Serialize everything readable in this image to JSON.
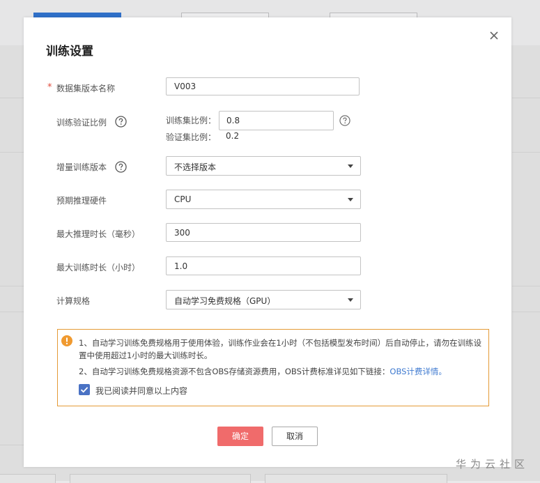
{
  "dialog": {
    "title": "训练设置",
    "close_icon": "close-icon"
  },
  "form": {
    "dataset_version": {
      "label": "数据集版本名称",
      "required_mark": "*",
      "value": "V003"
    },
    "validation_ratio": {
      "label": "训练验证比例",
      "train_label": "训练集比例：",
      "train_value": "0.8",
      "val_label": "验证集比例：",
      "val_value": "0.2"
    },
    "incremental_version": {
      "label": "增量训练版本",
      "selected": "不选择版本"
    },
    "inference_hardware": {
      "label": "预期推理硬件",
      "selected": "CPU"
    },
    "max_inference_time": {
      "label": "最大推理时长（毫秒）",
      "value": "300"
    },
    "max_training_time": {
      "label": "最大训练时长（小时）",
      "value": "1.0"
    },
    "compute_spec": {
      "label": "计算规格",
      "selected": "自动学习免费规格（GPU）"
    }
  },
  "notice": {
    "line1": "1、自动学习训练免费规格用于使用体验，训练作业会在1小时（不包括模型发布时间）后自动停止，请勿在训练设置中使用超过1小时的最大训练时长。",
    "line2_text": "2、自动学习训练免费规格资源不包含OBS存储资源费用，OBS计费标准详见如下链接：",
    "line2_link": "OBS计费详情。",
    "agree_label": "我已阅读并同意以上内容",
    "agree_checked": true
  },
  "buttons": {
    "confirm": "确定",
    "cancel": "取消"
  },
  "watermark": "华为云社区",
  "colors": {
    "primary": "#f06b6b",
    "link": "#3f7ad0",
    "warning_border": "#e49a36",
    "checkbox": "#4a72c4",
    "required": "#e04b3c"
  }
}
